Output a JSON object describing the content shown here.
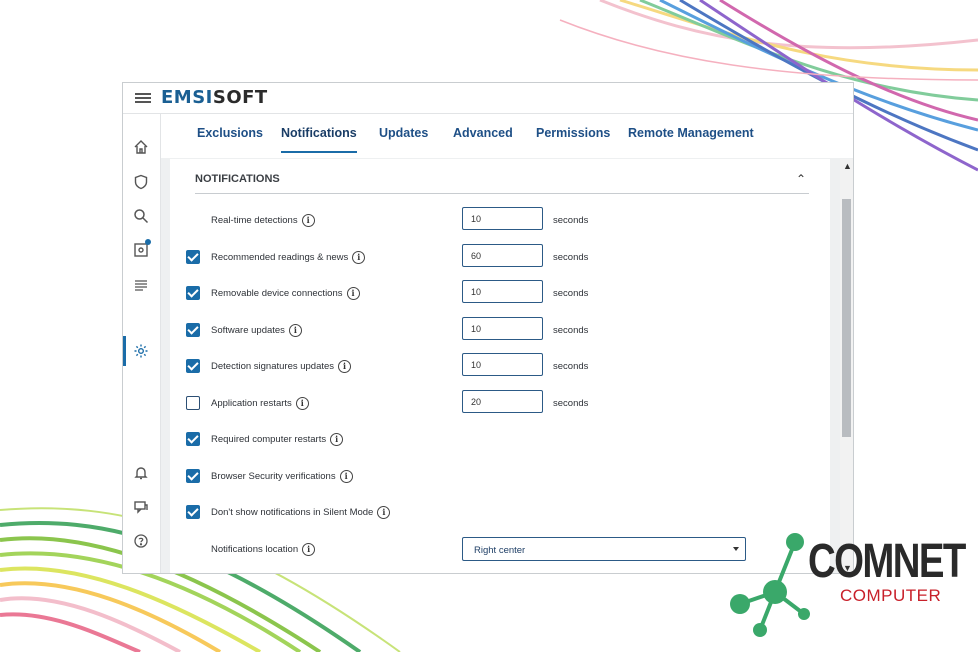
{
  "app": {
    "brand_a": "EMSI",
    "brand_b": "SOFT"
  },
  "sidebar": {
    "icons": [
      "home-icon",
      "shield-icon",
      "search-icon",
      "quarantine-icon",
      "logs-icon",
      "gear-icon",
      "bell-icon",
      "chat-icon",
      "help-icon"
    ],
    "active": "gear-icon"
  },
  "tabs": [
    {
      "label": "Exclusions",
      "active": false
    },
    {
      "label": "Notifications",
      "active": true
    },
    {
      "label": "Updates",
      "active": false
    },
    {
      "label": "Advanced",
      "active": false
    },
    {
      "label": "Permissions",
      "active": false
    },
    {
      "label": "Remote Management",
      "active": false
    }
  ],
  "section": {
    "title": "NOTIFICATIONS"
  },
  "rows": [
    {
      "label": "Real-time detections",
      "checkbox": null,
      "value": "10",
      "unit": "seconds"
    },
    {
      "label": "Recommended readings & news",
      "checkbox": true,
      "value": "60",
      "unit": "seconds"
    },
    {
      "label": "Removable device connections",
      "checkbox": true,
      "value": "10",
      "unit": "seconds"
    },
    {
      "label": "Software updates",
      "checkbox": true,
      "value": "10",
      "unit": "seconds"
    },
    {
      "label": "Detection signatures updates",
      "checkbox": true,
      "value": "10",
      "unit": "seconds"
    },
    {
      "label": "Application restarts",
      "checkbox": false,
      "value": "20",
      "unit": "seconds"
    },
    {
      "label": "Required computer restarts",
      "checkbox": true
    },
    {
      "label": "Browser Security verifications",
      "checkbox": true
    },
    {
      "label": "Don't show notifications in Silent Mode",
      "checkbox": true
    },
    {
      "label": "Notifications location",
      "checkbox": null,
      "select": "Right center"
    }
  ],
  "info_glyph": "i",
  "scroll": {
    "up": "▲",
    "down": "▼",
    "collapse": "⌃"
  },
  "logo": {
    "line1": "COMNET",
    "line2": "COMPUTER"
  },
  "colors": {
    "accent": "#1a6ca8",
    "brand": "#1a5f93",
    "logo_red": "#c8202a",
    "logo_green": "#3aa86a"
  }
}
